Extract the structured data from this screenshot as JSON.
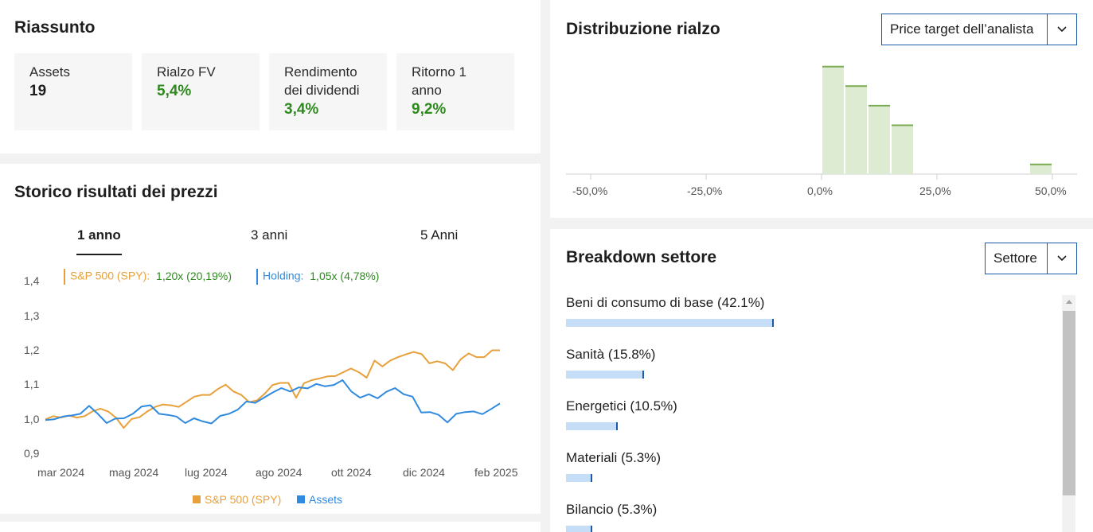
{
  "summary": {
    "title": "Riassunto",
    "cards": [
      {
        "label": "Assets",
        "value": "19"
      },
      {
        "label": "Rialzo FV",
        "value": "5,4%"
      },
      {
        "label": "Rendimento dei dividendi",
        "value": "3,4%"
      },
      {
        "label": "Ritorno 1 anno",
        "value": "9,2%"
      }
    ]
  },
  "history": {
    "title": "Storico risultati dei prezzi",
    "tabs": [
      "1 anno",
      "3 anni",
      "5 Anni"
    ],
    "active_tab": "1 anno",
    "legend_top": {
      "spy_label": "S&P 500 (SPY):",
      "spy_value": "1,20x (20,19%)",
      "holding_label": "Holding:",
      "holding_value": "1,05x (4,78%)"
    },
    "legend_bottom": {
      "spy": "S&P 500 (SPY)",
      "assets": "Assets"
    }
  },
  "distribution": {
    "title": "Distribuzione rialzo",
    "dropdown": "Price target dell’analista"
  },
  "sector": {
    "title": "Breakdown settore",
    "dropdown": "Settore",
    "items": [
      {
        "label": "Beni di consumo di base (42.1%)",
        "pct": 42.1
      },
      {
        "label": "Sanità (15.8%)",
        "pct": 15.8
      },
      {
        "label": "Energetici (10.5%)",
        "pct": 10.5
      },
      {
        "label": "Materiali (5.3%)",
        "pct": 5.3
      },
      {
        "label": "Bilancio (5.3%)",
        "pct": 5.3
      }
    ]
  },
  "colors": {
    "spy": "#e8a03a",
    "assets": "#2f8ae0",
    "green_value": "#2e8a1f",
    "dist_bar": "#deebd3",
    "dist_bar_top": "#7aab50",
    "sector_bar": "#c5ddf6",
    "accent_blue": "#1a5aa8"
  },
  "chart_data": [
    {
      "type": "line",
      "title": "",
      "x_tick_labels": [
        "mar 2024",
        "mag 2024",
        "lug 2024",
        "ago 2024",
        "ott 2024",
        "dic 2024",
        "feb 2025"
      ],
      "y_tick_labels": [
        "1,4",
        "1,3",
        "1,2",
        "1,1",
        "1,0",
        "0,9"
      ],
      "ylim": [
        0.9,
        1.4
      ],
      "grid": false,
      "legend": "bottom",
      "series": [
        {
          "name": "S&P 500 (SPY)",
          "values": [
            0.997,
            1.006,
            1.002,
            1.008,
            1.002,
            1.006,
            1.02,
            1.028,
            1.02,
            1.002,
            0.972,
            0.998,
            1.003,
            1.02,
            1.033,
            1.04,
            1.038,
            1.033,
            1.048,
            1.063,
            1.068,
            1.068,
            1.085,
            1.098,
            1.078,
            1.068,
            1.047,
            1.052,
            1.072,
            1.097,
            1.103,
            1.103,
            1.06,
            1.102,
            1.111,
            1.116,
            1.122,
            1.123,
            1.134,
            1.145,
            1.134,
            1.118,
            1.168,
            1.151,
            1.168,
            1.178,
            1.186,
            1.193,
            1.187,
            1.16,
            1.166,
            1.16,
            1.14,
            1.172,
            1.189,
            1.178,
            1.178,
            1.198,
            1.198
          ]
        },
        {
          "name": "Assets",
          "values": [
            0.995,
            0.997,
            1.005,
            1.008,
            1.013,
            1.036,
            1.013,
            0.986,
            0.999,
            1.0,
            1.013,
            1.034,
            1.038,
            1.013,
            1.01,
            1.005,
            0.986,
            1.0,
            0.991,
            0.985,
            1.007,
            1.013,
            1.025,
            1.049,
            1.045,
            1.06,
            1.075,
            1.088,
            1.078,
            1.09,
            1.087,
            1.1,
            1.093,
            1.097,
            1.111,
            1.078,
            1.06,
            1.07,
            1.058,
            1.077,
            1.088,
            1.07,
            1.063,
            1.017,
            1.018,
            1.01,
            0.988,
            1.013,
            1.018,
            1.02,
            1.012,
            1.027,
            1.043
          ]
        }
      ]
    },
    {
      "type": "bar",
      "title": "",
      "x_tick_labels": [
        "-50,0%",
        "-25,0%",
        "0,0%",
        "25,0%",
        "50,0%"
      ],
      "xlim": [
        -0.5,
        0.5
      ],
      "bins": [
        {
          "from": 0.0,
          "to": 0.05,
          "count": 5.5
        },
        {
          "from": 0.05,
          "to": 0.1,
          "count": 4.5
        },
        {
          "from": 0.1,
          "to": 0.15,
          "count": 3.5
        },
        {
          "from": 0.15,
          "to": 0.2,
          "count": 2.5
        },
        {
          "from": 0.45,
          "to": 0.5,
          "count": 0.5
        }
      ]
    },
    {
      "type": "bar",
      "title": "",
      "categories": [
        "Beni di consumo di base",
        "Sanità",
        "Energetici",
        "Materiali",
        "Bilancio"
      ],
      "values": [
        42.1,
        15.8,
        10.5,
        5.3,
        5.3
      ]
    }
  ]
}
